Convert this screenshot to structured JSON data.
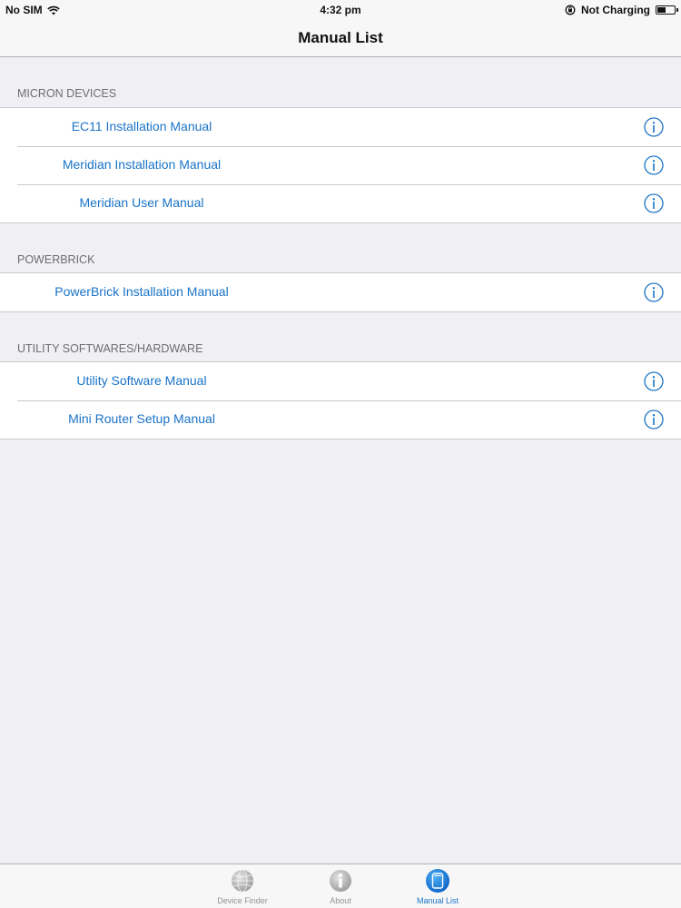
{
  "status_bar": {
    "carrier": "No SIM",
    "time": "4:32 pm",
    "charging": "Not Charging",
    "battery_level": 0.5
  },
  "nav": {
    "title": "Manual List"
  },
  "sections": [
    {
      "header": "MICRON DEVICES",
      "rows": [
        {
          "label": "EC11 Installation Manual",
          "icon": "info-circle-icon"
        },
        {
          "label": "Meridian Installation Manual",
          "icon": "info-circle-icon"
        },
        {
          "label": "Meridian User Manual",
          "icon": "info-circle-icon"
        }
      ]
    },
    {
      "header": "POWERBRICK",
      "rows": [
        {
          "label": "PowerBrick Installation Manual",
          "icon": "info-circle-icon"
        }
      ]
    },
    {
      "header": "UTILITY SOFTWARES/HARDWARE",
      "rows": [
        {
          "label": "Utility Software Manual",
          "icon": "info-circle-icon"
        },
        {
          "label": "Mini Router Setup Manual",
          "icon": "info-circle-icon"
        }
      ]
    }
  ],
  "tab_bar": {
    "tabs": [
      {
        "label": "Device Finder",
        "icon": "globe-icon",
        "active": false
      },
      {
        "label": "About",
        "icon": "info-icon",
        "active": false
      },
      {
        "label": "Manual List",
        "icon": "manual-icon",
        "active": true
      }
    ]
  },
  "colors": {
    "accent": "#1a73c7",
    "background": "#efeff4",
    "separator": "#c8c7cc",
    "header_text": "#6d6d72",
    "inactive_tab": "#929292"
  }
}
